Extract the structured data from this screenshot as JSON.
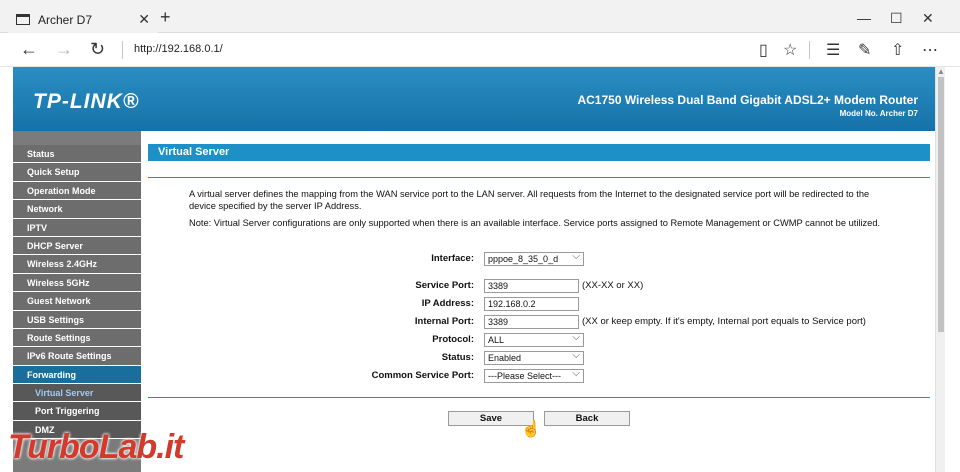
{
  "browser": {
    "tab_title": "Archer D7",
    "tab_close": "✕",
    "new_tab": "+",
    "url": "http://192.168.0.1/",
    "window_controls": {
      "minimize": "—",
      "maximize": "☐",
      "close": "✕"
    },
    "nav": {
      "back": "←",
      "forward": "→",
      "refresh": "↻"
    },
    "tools": {
      "reading_view": "▯",
      "favorite": "☆",
      "hub": "☰",
      "notes": "✎",
      "share": "⇧",
      "more": "⋯"
    }
  },
  "router": {
    "logo": "TP-LINK®",
    "product_name": "AC1750 Wireless Dual Band Gigabit ADSL2+ Modem Router",
    "model": "Model No. Archer D7"
  },
  "sidebar": {
    "items": [
      {
        "label": "Status"
      },
      {
        "label": "Quick Setup"
      },
      {
        "label": "Operation Mode"
      },
      {
        "label": "Network"
      },
      {
        "label": "IPTV"
      },
      {
        "label": "DHCP Server"
      },
      {
        "label": "Wireless 2.4GHz"
      },
      {
        "label": "Wireless 5GHz"
      },
      {
        "label": "Guest Network"
      },
      {
        "label": "USB Settings"
      },
      {
        "label": "Route Settings"
      },
      {
        "label": "IPv6 Route Settings"
      },
      {
        "label": "Forwarding"
      },
      {
        "label": "Virtual Server"
      },
      {
        "label": "Port Triggering"
      },
      {
        "label": "DMZ"
      }
    ]
  },
  "main": {
    "title": "Virtual Server",
    "description1": "A virtual server defines the mapping from the WAN service port to the LAN server. All requests from the Internet to the designated service port will be redirected to the device specified by the server IP Address.",
    "description2": "Note: Virtual Server configurations are only supported when there is an available interface. Service ports assigned to Remote Management or CWMP cannot be utilized.",
    "form": {
      "interface_label": "Interface:",
      "interface_value": "pppoe_8_35_0_d",
      "service_port_label": "Service Port:",
      "service_port_value": "3389",
      "service_port_hint": "(XX-XX or XX)",
      "ip_address_label": "IP Address:",
      "ip_address_value": "192.168.0.2",
      "internal_port_label": "Internal Port:",
      "internal_port_value": "3389",
      "internal_port_hint": "(XX or keep empty. If it's empty, Internal port equals to Service port)",
      "protocol_label": "Protocol:",
      "protocol_value": "ALL",
      "status_label": "Status:",
      "status_value": "Enabled",
      "common_service_label": "Common Service Port:",
      "common_service_value": "---Please Select---"
    },
    "save_label": "Save",
    "back_label": "Back"
  },
  "watermark": "TurboLab.it"
}
